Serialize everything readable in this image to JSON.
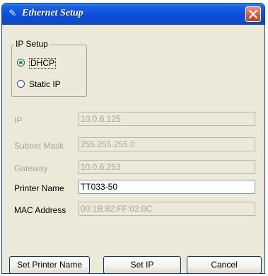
{
  "window": {
    "title": "Ethernet Setup"
  },
  "ip_setup": {
    "legend": "IP Setup",
    "options": [
      {
        "label": "DHCP",
        "selected": true
      },
      {
        "label": "Static IP",
        "selected": false
      }
    ]
  },
  "fields": {
    "ip": {
      "label": "IP",
      "value": "10.0.6.125"
    },
    "subnet": {
      "label": "Subnet Mask",
      "value": "255.255.255.0"
    },
    "gateway": {
      "label": "Gateway",
      "value": "10.0.6.253"
    },
    "printer_name": {
      "label": "Printer Name",
      "value": "TT033-50"
    },
    "mac": {
      "label": "MAC Address",
      "value": "00:1B:82:FF:02:0C"
    }
  },
  "buttons": {
    "set_printer_name": "Set Printer Name",
    "set_ip": "Set IP",
    "cancel": "Cancel"
  },
  "colors": {
    "title_bar": "#0a4fd8",
    "close_button": "#d9562f",
    "dialog_bg": "#ece9d8"
  }
}
